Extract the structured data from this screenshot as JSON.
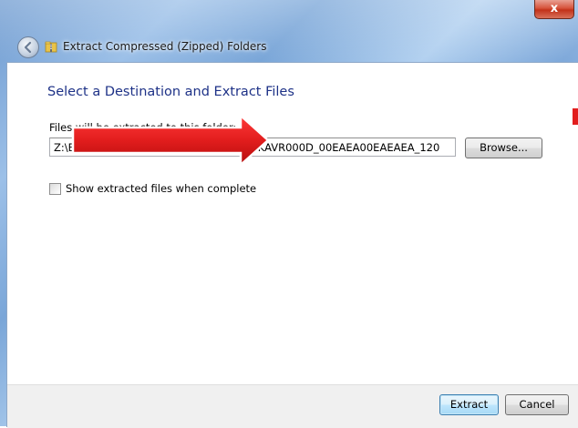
{
  "window": {
    "title": "Extract Compressed (Zipped) Folders",
    "close_label": "x"
  },
  "wizard": {
    "heading": "Select a Destination and Extract Files",
    "destination_label": "Files will be extracted to this folder:",
    "destination_value": "Z:\\Bsandifer On My Mac\\Downloads\\C0KAVR000D_00EAEA00EAEAEA_120",
    "browse_label": "Browse...",
    "show_files_label": "Show extracted files when complete",
    "show_files_checked": false
  },
  "footer": {
    "extract_label": "Extract",
    "cancel_label": "Cancel"
  },
  "colors": {
    "heading": "#1e3287",
    "annotation_arrow": "#e21d1d",
    "window_frame": "#7aa6d8"
  },
  "icons": [
    "back-arrow-icon",
    "folder-zip-icon",
    "close-icon",
    "red-arrow-annotation-icon"
  ]
}
